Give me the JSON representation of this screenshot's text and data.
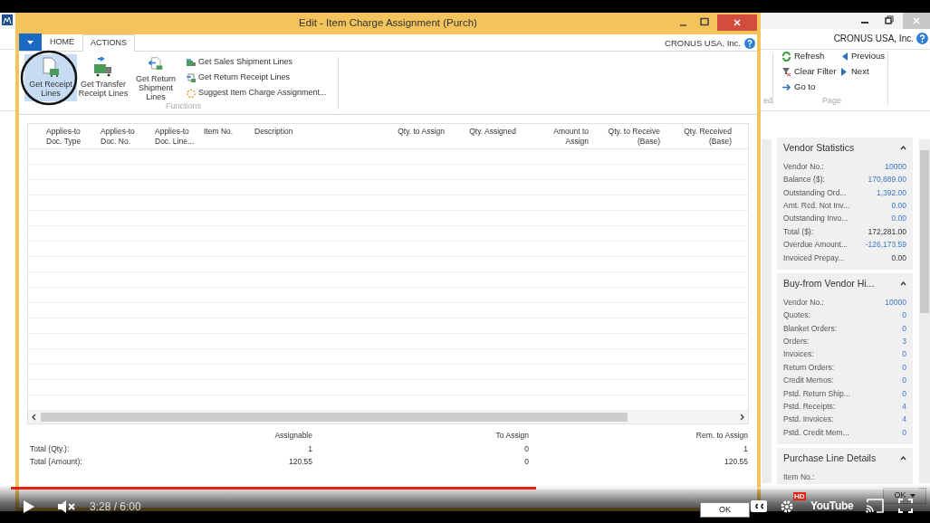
{
  "background_window": {
    "company": "CRONUS USA, Inc.",
    "ribbon_actions": [
      {
        "kind": "refresh",
        "label": "Refresh"
      },
      {
        "kind": "previous",
        "label": "Previous"
      },
      {
        "kind": "filter",
        "label": "Clear Filter"
      },
      {
        "kind": "next",
        "label": "Next"
      },
      {
        "kind": "goto",
        "label": "Go to"
      }
    ],
    "ribbon_group_cut": "ed",
    "ribbon_group": "Page",
    "factboxes": [
      {
        "title": "Vendor Statistics",
        "fields": [
          {
            "label": "Vendor No.:",
            "value": "10000",
            "link": true
          },
          {
            "label": "Balance ($):",
            "value": "170,889.00",
            "link": true
          },
          {
            "label": "Outstanding Ord...",
            "value": "1,392.00",
            "link": true
          },
          {
            "label": "Amt. Rcd. Not Inv...",
            "value": "0.00",
            "link": true
          },
          {
            "label": "Outstanding Invo...",
            "value": "0.00",
            "link": true
          },
          {
            "label": "Total ($):",
            "value": "172,281.00",
            "link": false
          },
          {
            "label": "Overdue Amount...",
            "value": "-126,173.59",
            "link": true
          },
          {
            "label": "Invoiced Prepay...",
            "value": "0.00",
            "link": false
          }
        ]
      },
      {
        "title": "Buy-from Vendor Hi...",
        "fields": [
          {
            "label": "Vendor No.:",
            "value": "10000",
            "link": true
          },
          {
            "label": "Quotes:",
            "value": "0",
            "link": true
          },
          {
            "label": "Blanket Orders:",
            "value": "0",
            "link": true
          },
          {
            "label": "Orders:",
            "value": "3",
            "link": true
          },
          {
            "label": "Invoices:",
            "value": "0",
            "link": true
          },
          {
            "label": "Return Orders:",
            "value": "0",
            "link": true
          },
          {
            "label": "Credit Memos:",
            "value": "0",
            "link": true
          },
          {
            "label": "Pstd. Return Ship...",
            "value": "0",
            "link": true
          },
          {
            "label": "Pstd. Receipts:",
            "value": "4",
            "link": true
          },
          {
            "label": "Pstd. Invoices:",
            "value": "4",
            "link": true
          },
          {
            "label": "Pstd. Credit Mem...",
            "value": "0",
            "link": true
          }
        ]
      },
      {
        "title": "Purchase Line Details",
        "fields": [
          {
            "label": "Item No.:"
          }
        ]
      }
    ],
    "ok_button": "OK"
  },
  "dialog": {
    "title": "Edit - Item Charge Assignment (Purch)",
    "tabs": [
      {
        "label": "HOME",
        "selected": false
      },
      {
        "label": "ACTIONS",
        "selected": true
      }
    ],
    "company": "CRONUS USA, Inc.",
    "big_actions": [
      {
        "kind": "receipt",
        "label": "Get Receipt Lines",
        "selected": true
      },
      {
        "kind": "transfer",
        "label": "Get Transfer Receipt Lines",
        "selected": false
      },
      {
        "kind": "return",
        "label": "Get Return Shipment Lines",
        "selected": false
      }
    ],
    "small_actions": [
      {
        "kind": "sales",
        "label": "Get Sales Shipment Lines"
      },
      {
        "kind": "returnreceipt",
        "label": "Get Return Receipt Lines"
      },
      {
        "kind": "suggest",
        "label": "Suggest Item Charge Assignment..."
      }
    ],
    "ribbon_group": "Functions",
    "columns": [
      {
        "label": "Applies-to Doc. Type"
      },
      {
        "label": "Applies-to Doc. No."
      },
      {
        "label": "Applies-to Doc. Line..."
      },
      {
        "label": "Item No."
      },
      {
        "label": "Description"
      },
      {
        "label": "Qty. to Assign"
      },
      {
        "label": "Qty. Assigned"
      },
      {
        "label": "Amount to Assign"
      },
      {
        "label": "Qty. to Receive (Base)"
      },
      {
        "label": "Qty. Received (Base)"
      }
    ],
    "totals": {
      "headers": [
        "Assignable",
        "To Assign",
        "Rem. to Assign"
      ],
      "rows": [
        {
          "label": "Total (Qty.):",
          "values": [
            "1",
            "0",
            "1"
          ]
        },
        {
          "label": "Total (Amount):",
          "values": [
            "120.55",
            "0",
            "120.55"
          ]
        }
      ]
    },
    "ok_button": "OK"
  },
  "video_player": {
    "progress": {
      "level": 0.578
    },
    "time": "3:28 / 6:00",
    "hd_badge": "HD",
    "logo": "YouTube"
  }
}
